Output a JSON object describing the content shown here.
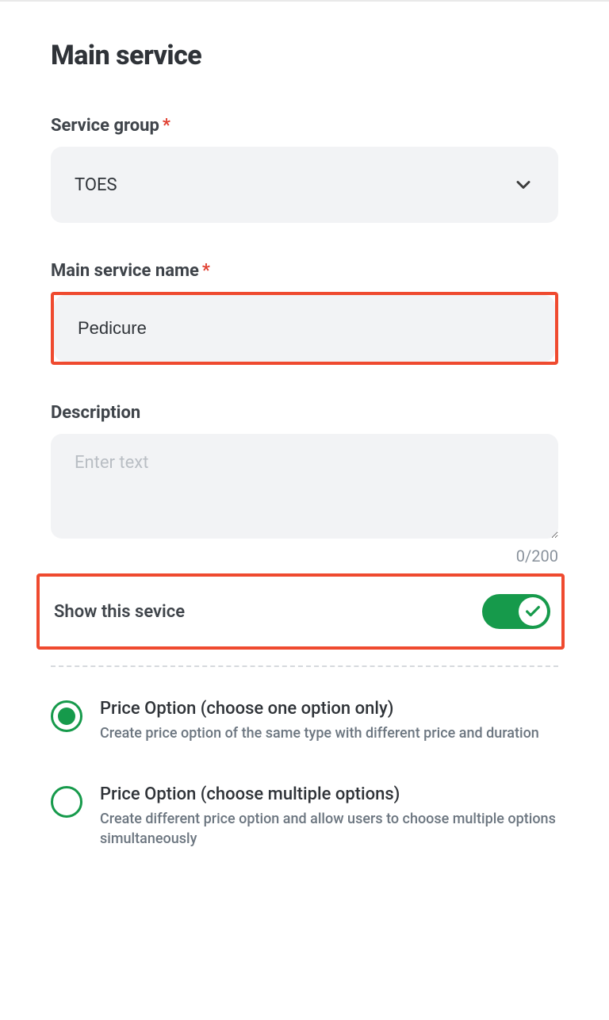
{
  "title": "Main service",
  "serviceGroup": {
    "label": "Service group",
    "value": "TOES"
  },
  "serviceName": {
    "label": "Main service name",
    "value": "Pedicure"
  },
  "description": {
    "label": "Description",
    "placeholder": "Enter text",
    "value": "",
    "counter": "0/200"
  },
  "showService": {
    "label": "Show this sevice",
    "enabled": true
  },
  "priceOptions": [
    {
      "title": "Price Option (choose one option only)",
      "desc": "Create price option of the same type with different price and duration",
      "selected": true
    },
    {
      "title": "Price Option (choose multiple options)",
      "desc": "Create different price option and allow users to choose multiple options simultaneously",
      "selected": false
    }
  ]
}
